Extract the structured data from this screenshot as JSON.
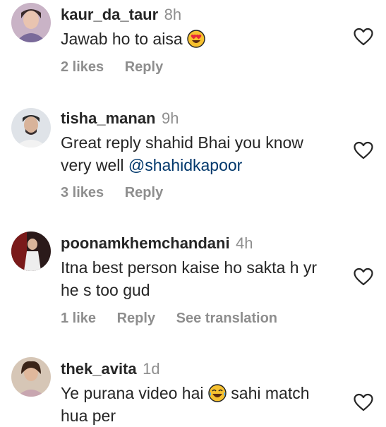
{
  "comments": [
    {
      "username": "kaur_da_taur",
      "time": "8h",
      "text": "Jawab ho to aisa",
      "emoji": "heart-eyes-emoji",
      "likes": "2 likes",
      "reply": "Reply"
    },
    {
      "username": "tisha_manan",
      "time": "9h",
      "text_line1": "Great reply shahid Bhai you know",
      "text_line2_prefix": "very well",
      "mention": "@shahidkapoor",
      "likes": "3 likes",
      "reply": "Reply"
    },
    {
      "username": "poonamkhemchandani",
      "time": "4h",
      "text_line1": "Itna best person kaise ho sakta h yr",
      "text_line2": "he s too gud",
      "likes": "1 like",
      "reply": "Reply",
      "translate": "See translation"
    },
    {
      "username": "thek_avita",
      "time": "1d",
      "text_prefix": "Ye purana video hai",
      "emoji": "laughing-tears-emoji",
      "text_suffix": "sahi match",
      "text_line2": "hua per"
    }
  ],
  "colors": {
    "primary_text": "#262626",
    "secondary_text": "#8e8e8e",
    "mention": "#00376b"
  },
  "icons": {
    "like": "heart-outline-icon"
  }
}
